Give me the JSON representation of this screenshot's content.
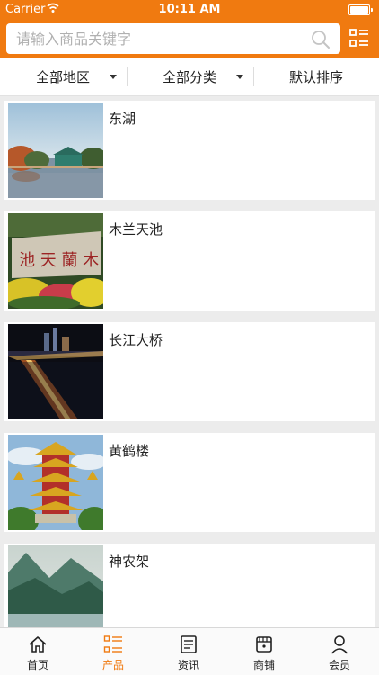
{
  "status_bar": {
    "carrier": "Carrier",
    "time": "10:11 AM"
  },
  "search": {
    "placeholder": "请输入商品关键字"
  },
  "filters": [
    {
      "label": "全部地区"
    },
    {
      "label": "全部分类"
    },
    {
      "label": "默认排序"
    }
  ],
  "items": [
    {
      "title": "东湖",
      "image": "lake-pavilion-image"
    },
    {
      "title": "木兰天池",
      "image": "stone-monument-image"
    },
    {
      "title": "长江大桥",
      "image": "night-bridge-image"
    },
    {
      "title": "黄鹤楼",
      "image": "tower-image"
    },
    {
      "title": "神农架",
      "image": "mountain-lake-image"
    }
  ],
  "tabs": [
    {
      "label": "首页",
      "icon": "home-icon"
    },
    {
      "label": "产品",
      "icon": "product-list-icon",
      "active": true
    },
    {
      "label": "资讯",
      "icon": "news-icon"
    },
    {
      "label": "商铺",
      "icon": "shop-icon"
    },
    {
      "label": "会员",
      "icon": "member-icon"
    }
  ],
  "colors": {
    "accent": "#f07a10",
    "background": "#ececec"
  }
}
